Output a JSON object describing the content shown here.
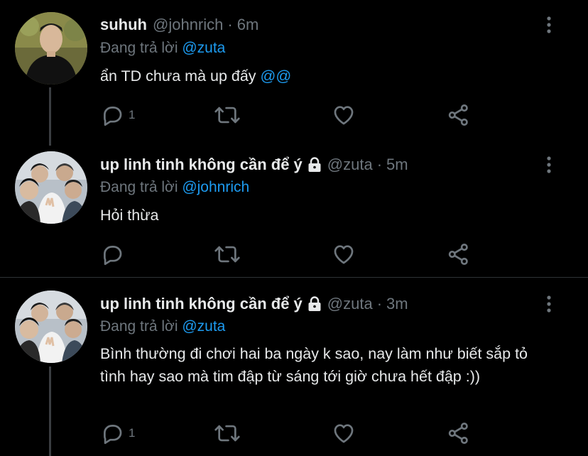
{
  "colors": {
    "background": "#000000",
    "text_primary": "#e7e9ea",
    "text_secondary": "#6e767d",
    "link": "#1d9bf0",
    "divider": "#2f3336"
  },
  "tweets": [
    {
      "name": "suhuh",
      "handle": "@johnrich",
      "separator": "·",
      "time": "6m",
      "locked": false,
      "replying_prefix": "Đang trả lời",
      "replying_to": "@zuta",
      "text": "ẩn TD chưa mà up đấy",
      "text_emph": "@@",
      "reply_count": "1",
      "retweet_count": "",
      "like_count": "",
      "icons": [
        "reply-icon",
        "retweet-icon",
        "like-icon",
        "share-icon",
        "more-options-icon"
      ]
    },
    {
      "name": "up linh tinh không cần để ý",
      "handle": "@zuta",
      "separator": "·",
      "time": "5m",
      "locked": true,
      "replying_prefix": "Đang trả lời",
      "replying_to": "@johnrich",
      "text": "Hỏi thừa",
      "text_emph": "",
      "reply_count": "",
      "retweet_count": "",
      "like_count": "",
      "icons": [
        "reply-icon",
        "retweet-icon",
        "like-icon",
        "share-icon",
        "more-options-icon"
      ]
    },
    {
      "name": "up linh tinh không cần để ý",
      "handle": "@zuta",
      "separator": "·",
      "time": "3m",
      "locked": true,
      "replying_prefix": "Đang trả lời",
      "replying_to": "@zuta",
      "text": "Bình thường đi chơi hai ba ngày k sao, nay làm như biết sắp tỏ tình hay sao mà tim đập từ sáng tới giờ chưa hết đập :))",
      "text_emph": "",
      "reply_count": "1",
      "retweet_count": "",
      "like_count": "",
      "icons": [
        "reply-icon",
        "retweet-icon",
        "like-icon",
        "share-icon",
        "more-options-icon"
      ]
    }
  ]
}
